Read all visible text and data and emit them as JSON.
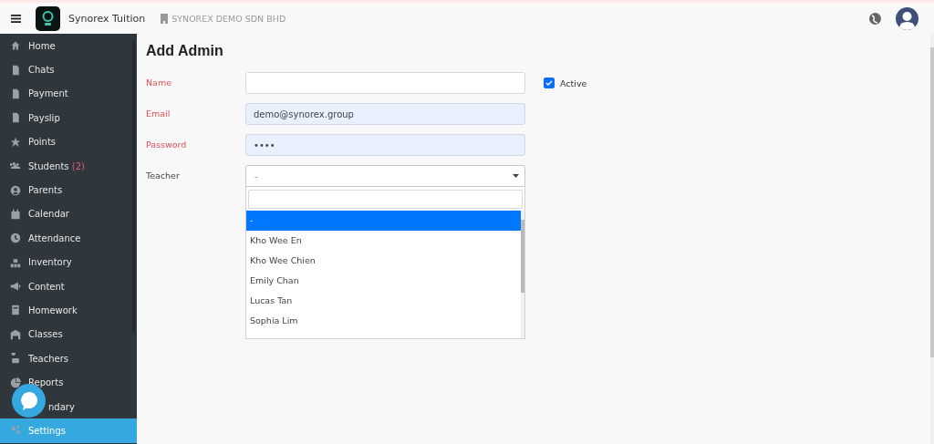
{
  "header": {
    "app_name": "Synorex Tuition",
    "company": "SYNOREX DEMO SDN BHD"
  },
  "sidebar": {
    "items": [
      {
        "label": "Home",
        "selected": false
      },
      {
        "label": "Chats",
        "selected": false
      },
      {
        "label": "Payment",
        "selected": false
      },
      {
        "label": "Payslip",
        "selected": false
      },
      {
        "label": "Points",
        "selected": false
      },
      {
        "label": "Students",
        "badge": "(2)",
        "selected": false
      },
      {
        "label": "Parents",
        "selected": false
      },
      {
        "label": "Calendar",
        "selected": false
      },
      {
        "label": "Attendance",
        "selected": false
      },
      {
        "label": "Inventory",
        "selected": false
      },
      {
        "label": "Content",
        "selected": false
      },
      {
        "label": "Homework",
        "selected": false
      },
      {
        "label": "Classes",
        "selected": false
      },
      {
        "label": "Teachers",
        "selected": false
      },
      {
        "label": "Reports",
        "selected": false
      },
      {
        "label": "ndary",
        "selected": false
      },
      {
        "label": "Settings",
        "selected": true
      }
    ]
  },
  "form": {
    "title": "Add Admin",
    "fields": [
      {
        "label": "Name",
        "required": true,
        "autofilled": false
      },
      {
        "label": "Email",
        "required": true,
        "value": "demo@synorex.group",
        "autofilled": true
      },
      {
        "label": "Password",
        "required": true,
        "value": "••••",
        "autofilled": true
      }
    ],
    "active": {
      "label": "Active",
      "checked": true
    },
    "teacher": {
      "label": "Teacher",
      "required": false,
      "value": "-",
      "expanded": true,
      "options": [
        {
          "label": "-",
          "selected": true
        },
        {
          "label": "Kho Wee En",
          "selected": false
        },
        {
          "label": "Kho Wee Chien",
          "selected": false
        },
        {
          "label": "Emily Chan",
          "selected": false
        },
        {
          "label": "Lucas Tan",
          "selected": false
        },
        {
          "label": "Sophia Lim",
          "selected": false
        }
      ]
    }
  }
}
